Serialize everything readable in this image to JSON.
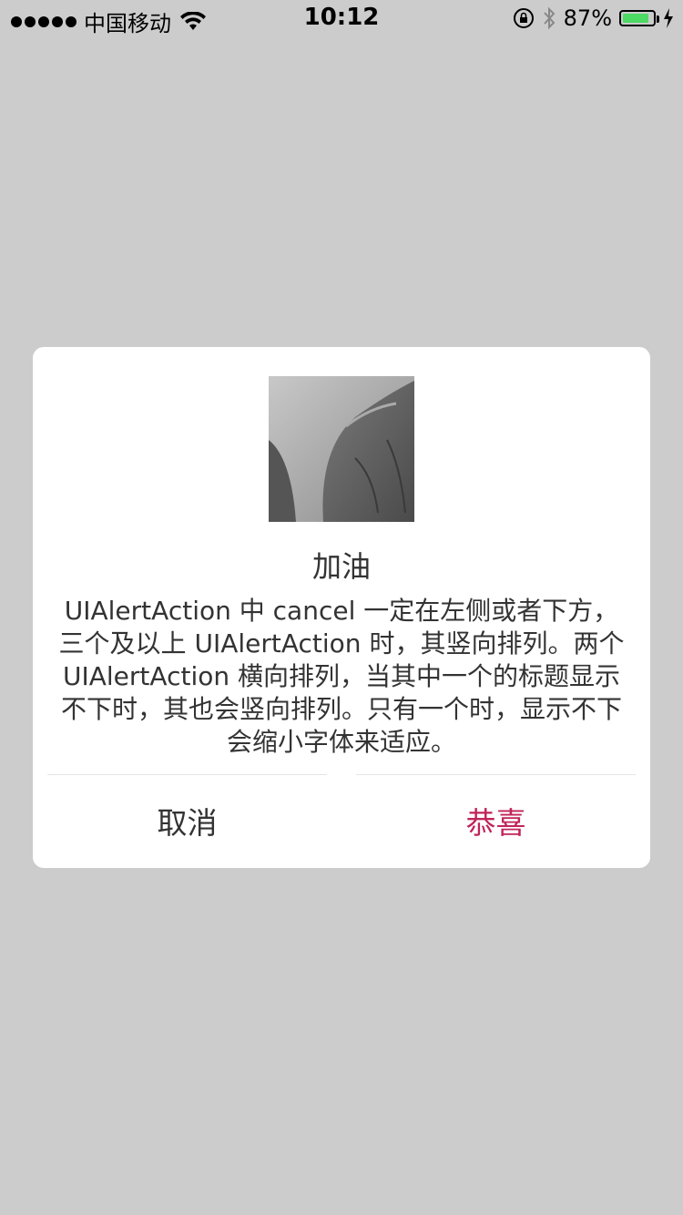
{
  "status_bar": {
    "carrier": "中国移动",
    "time": "10:12",
    "battery_percent": "87%",
    "battery_level": 0.87,
    "battery_color": "#4cd964"
  },
  "alert": {
    "image_name": "person-photo",
    "title": "加油",
    "message": "UIAlertAction 中 cancel 一定在左侧或者下方，三个及以上 UIAlertAction 时，其竖向排列。两个 UIAlertAction 横向排列，当其中一个的标题显示不下时，其也会竖向排列。只有一个时，显示不下会缩小字体来适应。",
    "cancel_label": "取消",
    "ok_label": "恭喜",
    "ok_color": "#c0245a"
  }
}
